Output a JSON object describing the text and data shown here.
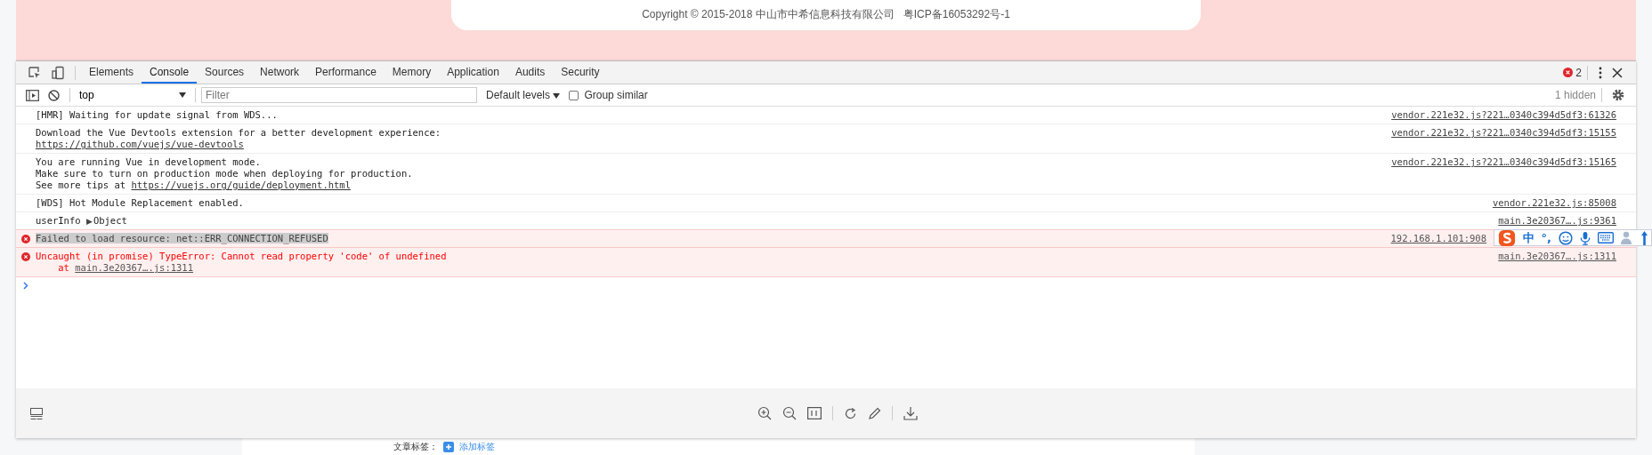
{
  "banner": {
    "copyright": "Copyright © 2015-2018 中山市中希信息科技有限公司",
    "icp": "粤ICP备16053292号-1"
  },
  "tabs": [
    {
      "label": "Elements",
      "selected": false
    },
    {
      "label": "Console",
      "selected": true
    },
    {
      "label": "Sources",
      "selected": false
    },
    {
      "label": "Network",
      "selected": false
    },
    {
      "label": "Performance",
      "selected": false
    },
    {
      "label": "Memory",
      "selected": false
    },
    {
      "label": "Application",
      "selected": false
    },
    {
      "label": "Audits",
      "selected": false
    },
    {
      "label": "Security",
      "selected": false
    }
  ],
  "error_count": "2",
  "filter_bar": {
    "context": "top",
    "placeholder": "Filter",
    "levels": "Default levels",
    "group_similar": {
      "label": "Group similar",
      "checked": false
    },
    "hidden": "1 hidden"
  },
  "messages": [
    {
      "kind": "log",
      "lines": [
        {
          "text": "[HMR] Waiting for update signal from WDS..."
        }
      ],
      "source": "vendor.221e32.js?221…0340c394d5df3:61326"
    },
    {
      "kind": "log",
      "lines": [
        {
          "text": "Download the Vue Devtools extension for a better development experience:"
        },
        {
          "link": "https://github.com/vuejs/vue-devtools"
        }
      ],
      "source": "vendor.221e32.js?221…0340c394d5df3:15155"
    },
    {
      "kind": "log",
      "lines": [
        {
          "text": "You are running Vue in development mode."
        },
        {
          "text": "Make sure to turn on production mode when deploying for production."
        },
        {
          "text": "See more tips at ",
          "link": "https://vuejs.org/guide/deployment.html"
        }
      ],
      "source": "vendor.221e32.js?221…0340c394d5df3:15165"
    },
    {
      "kind": "log",
      "lines": [
        {
          "text": "[WDS] Hot Module Replacement enabled."
        }
      ],
      "source": "vendor.221e32.js:85008"
    },
    {
      "kind": "object",
      "label": "userInfo",
      "toggle": "▶",
      "value": "Object",
      "source": "main.3e20367….js:9361"
    },
    {
      "kind": "error",
      "highlighted": true,
      "lines": [
        {
          "text": "Failed to load resource: net::ERR_CONNECTION_REFUSED"
        }
      ],
      "source": "192.168.1.101:908"
    },
    {
      "kind": "error",
      "highlighted": false,
      "lines": [
        {
          "text": "Uncaught (in promise) TypeError: Cannot read property 'code' of undefined"
        },
        {
          "text": "    at ",
          "link": "main.3e20367….js:1311"
        }
      ],
      "source": "main.3e20367….js:1311"
    }
  ],
  "ime": {
    "mode": "中",
    "punct": "°,"
  },
  "page_below": {
    "label": "文章标签：",
    "link": "添加标签"
  }
}
